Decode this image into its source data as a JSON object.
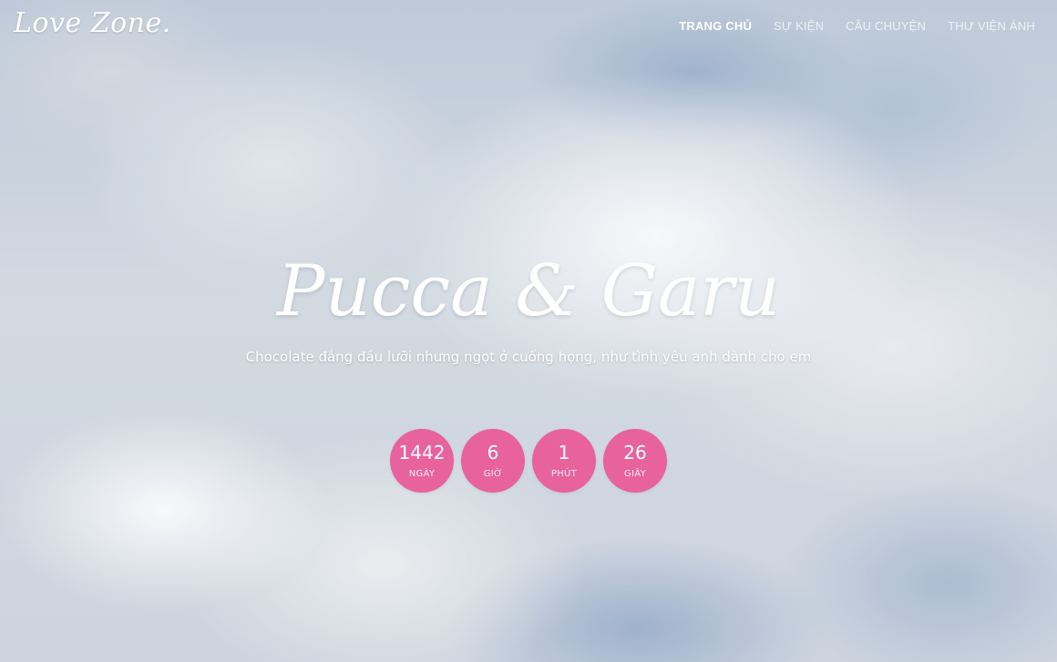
{
  "header": {
    "logo_text": "Love Zone.",
    "nav": [
      {
        "label": "TRANG CHỦ",
        "active": true
      },
      {
        "label": "SỰ KIỆN",
        "active": false
      },
      {
        "label": "CÂU CHUYỆN",
        "active": false
      },
      {
        "label": "THƯ VIỆN ẢNH",
        "active": false
      }
    ]
  },
  "hero": {
    "title": "Pucca & Garu",
    "subtitle": "Chocolate đắng đầu lưỡi nhưng ngọt ở cuống họng, như tình yêu anh dành cho em"
  },
  "countdown": [
    {
      "value": "1442",
      "label": "NGÀY"
    },
    {
      "value": "6",
      "label": "GIỜ"
    },
    {
      "value": "1",
      "label": "PHÚT"
    },
    {
      "value": "26",
      "label": "GIÂY"
    }
  ],
  "colors": {
    "accent_pink": "#e8629e",
    "text_white": "#ffffff"
  }
}
